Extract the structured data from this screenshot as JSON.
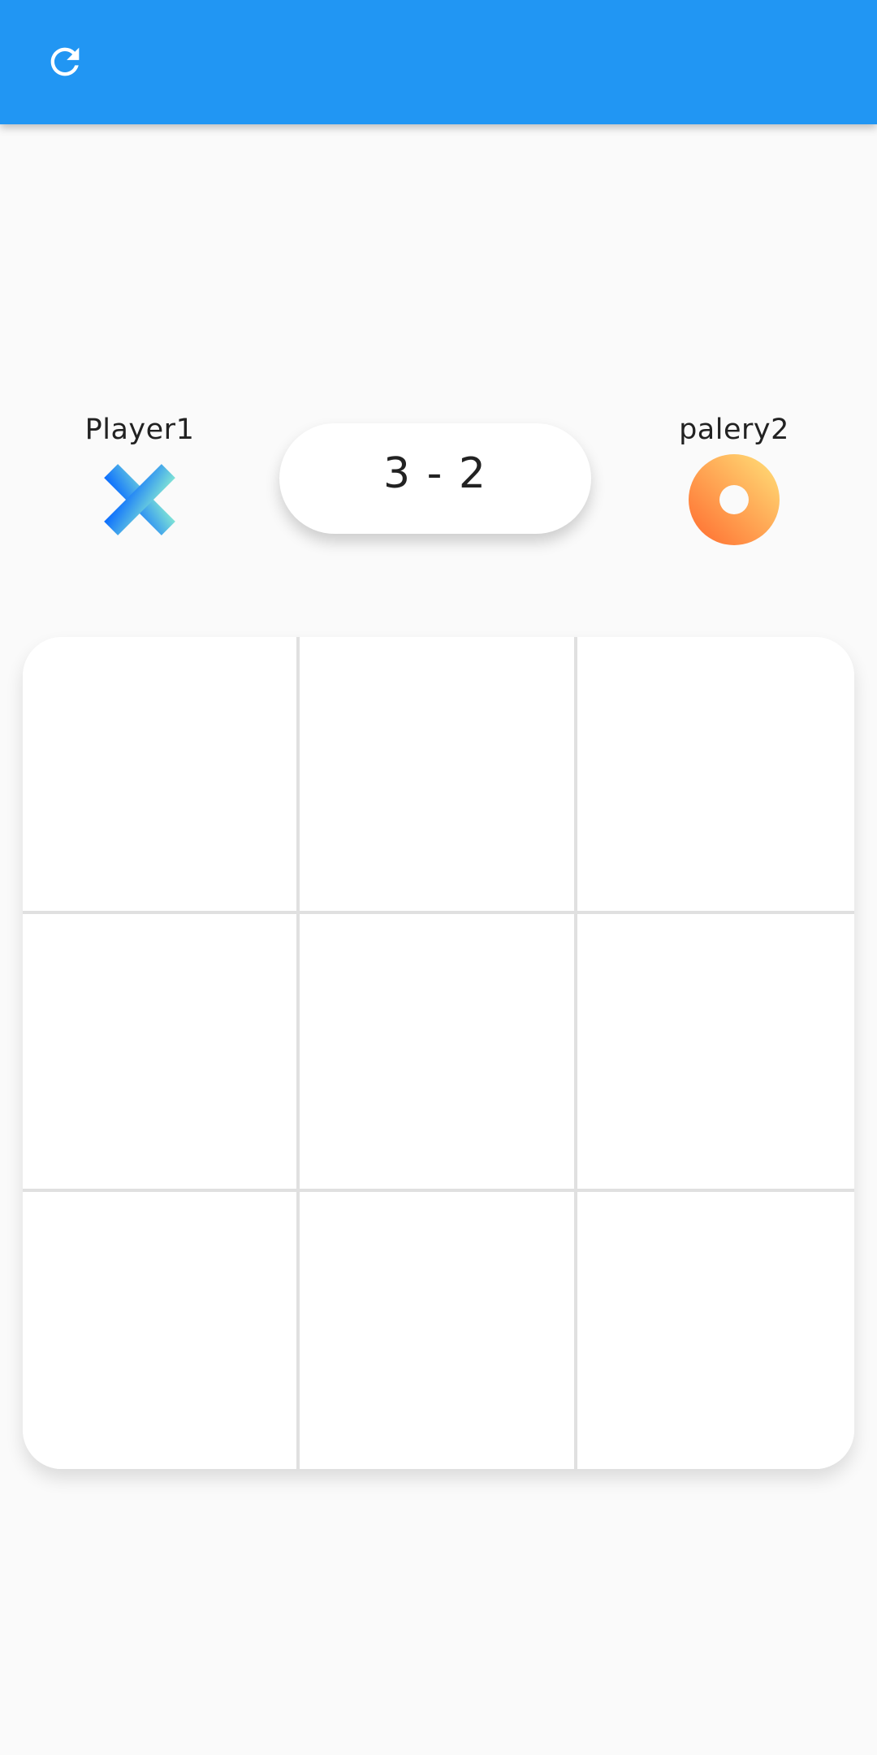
{
  "appbar": {
    "color": "#2196f3",
    "refresh_icon": "refresh-icon"
  },
  "players": [
    {
      "name": "Player1",
      "mark": "x-mark-icon"
    },
    {
      "name": "palery2",
      "mark": "o-mark-icon"
    }
  ],
  "score": {
    "text": "3 - 2"
  },
  "board": {
    "rows": 3,
    "cols": 3,
    "cells": [
      "",
      "",
      "",
      "",
      "",
      "",
      "",
      "",
      ""
    ]
  }
}
